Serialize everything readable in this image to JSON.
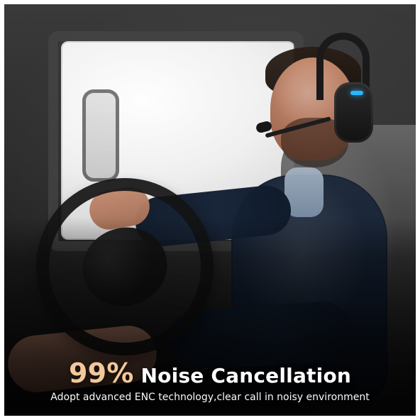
{
  "caption": {
    "headline_percent": "99%",
    "headline_text": "Noise Cancellation",
    "subline": "Adopt advanced ENC technology,clear call in noisy environment"
  },
  "colors": {
    "headline_percent": "#f2c89b",
    "caption_text": "#ffffff",
    "headset_led": "#28b7ff"
  },
  "icons": {
    "headset": "headset-icon",
    "microphone": "microphone-icon"
  }
}
